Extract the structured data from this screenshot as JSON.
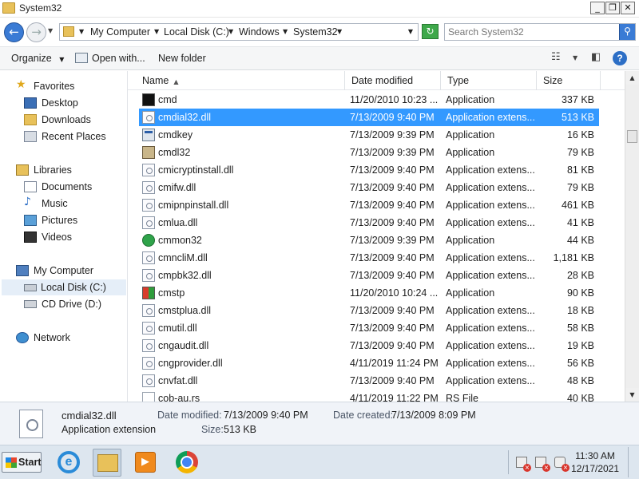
{
  "window": {
    "title": "System32",
    "minimize_glyph": "_",
    "maximize_glyph": "❐",
    "close_glyph": "✕"
  },
  "address": {
    "back_glyph": "←",
    "forward_glyph": "→",
    "dropdown_glyph": "▼",
    "crumbs": [
      "My Computer",
      "Local Disk (C:)",
      "Windows",
      "System32"
    ],
    "refresh_glyph": "↻",
    "search_placeholder": "Search System32",
    "search_glyph": "⚲"
  },
  "toolbar": {
    "organize": "Organize",
    "open_with": "Open with...",
    "new_folder": "New folder",
    "dropdown_glyph": "▼",
    "help_glyph": "?"
  },
  "nav": {
    "favorites": "Favorites",
    "desktop": "Desktop",
    "downloads": "Downloads",
    "recent_places": "Recent Places",
    "libraries": "Libraries",
    "documents": "Documents",
    "music": "Music",
    "pictures": "Pictures",
    "videos": "Videos",
    "my_computer": "My Computer",
    "local_disk": "Local Disk (C:)",
    "cd_drive": "CD Drive (D:)",
    "network": "Network"
  },
  "columns": {
    "name": "Name",
    "date": "Date modified",
    "type": "Type",
    "size": "Size",
    "sort_glyph": "▲"
  },
  "files": [
    {
      "name": "cmd",
      "date": "11/20/2010 10:23 ...",
      "type": "Application",
      "size": "337 KB",
      "icon": "cmd-icon"
    },
    {
      "name": "cmdial32.dll",
      "date": "7/13/2009 9:40 PM",
      "type": "Application extens...",
      "size": "513 KB",
      "icon": "dll-icon"
    },
    {
      "name": "cmdkey",
      "date": "7/13/2009 9:39 PM",
      "type": "Application",
      "size": "16 KB",
      "icon": "app-icon"
    },
    {
      "name": "cmdl32",
      "date": "7/13/2009 9:39 PM",
      "type": "Application",
      "size": "79 KB",
      "icon": "tool-icon"
    },
    {
      "name": "cmicryptinstall.dll",
      "date": "7/13/2009 9:40 PM",
      "type": "Application extens...",
      "size": "81 KB",
      "icon": "dll-icon"
    },
    {
      "name": "cmifw.dll",
      "date": "7/13/2009 9:40 PM",
      "type": "Application extens...",
      "size": "79 KB",
      "icon": "dll-icon"
    },
    {
      "name": "cmipnpinstall.dll",
      "date": "7/13/2009 9:40 PM",
      "type": "Application extens...",
      "size": "461 KB",
      "icon": "dll-icon"
    },
    {
      "name": "cmlua.dll",
      "date": "7/13/2009 9:40 PM",
      "type": "Application extens...",
      "size": "41 KB",
      "icon": "dll-icon"
    },
    {
      "name": "cmmon32",
      "date": "7/13/2009 9:39 PM",
      "type": "Application",
      "size": "44 KB",
      "icon": "green-app-icon"
    },
    {
      "name": "cmncliM.dll",
      "date": "7/13/2009 9:40 PM",
      "type": "Application extens...",
      "size": "1,181 KB",
      "icon": "dll-icon"
    },
    {
      "name": "cmpbk32.dll",
      "date": "7/13/2009 9:40 PM",
      "type": "Application extens...",
      "size": "28 KB",
      "icon": "dll-icon"
    },
    {
      "name": "cmstp",
      "date": "11/20/2010 10:24 ...",
      "type": "Application",
      "size": "90 KB",
      "icon": "color-app-icon"
    },
    {
      "name": "cmstplua.dll",
      "date": "7/13/2009 9:40 PM",
      "type": "Application extens...",
      "size": "18 KB",
      "icon": "dll-icon"
    },
    {
      "name": "cmutil.dll",
      "date": "7/13/2009 9:40 PM",
      "type": "Application extens...",
      "size": "58 KB",
      "icon": "dll-icon"
    },
    {
      "name": "cngaudit.dll",
      "date": "7/13/2009 9:40 PM",
      "type": "Application extens...",
      "size": "19 KB",
      "icon": "dll-icon"
    },
    {
      "name": "cngprovider.dll",
      "date": "4/11/2019 11:24 PM",
      "type": "Application extens...",
      "size": "56 KB",
      "icon": "dll-icon"
    },
    {
      "name": "cnvfat.dll",
      "date": "7/13/2009 9:40 PM",
      "type": "Application extens...",
      "size": "48 KB",
      "icon": "dll-icon"
    },
    {
      "name": "cob-au.rs",
      "date": "4/11/2019 11:22 PM",
      "type": "RS File",
      "size": "40 KB",
      "icon": "file-icon"
    }
  ],
  "selected_index": 1,
  "details": {
    "filename": "cmdial32.dll",
    "filetype": "Application extension",
    "modified_label": "Date modified:",
    "modified_value": "7/13/2009 9:40 PM",
    "created_label": "Date created:",
    "created_value": "7/13/2009 8:09 PM",
    "size_label": "Size:",
    "size_value": "513 KB"
  },
  "taskbar": {
    "start_label": "Start",
    "ie_glyph": "e",
    "media_glyph": "▶",
    "time": "11:30 AM",
    "date": "12/17/2021"
  },
  "colors": {
    "selection": "#3399ff",
    "nav_selected": "#e5eef8",
    "taskbar": "#dde6ef"
  }
}
